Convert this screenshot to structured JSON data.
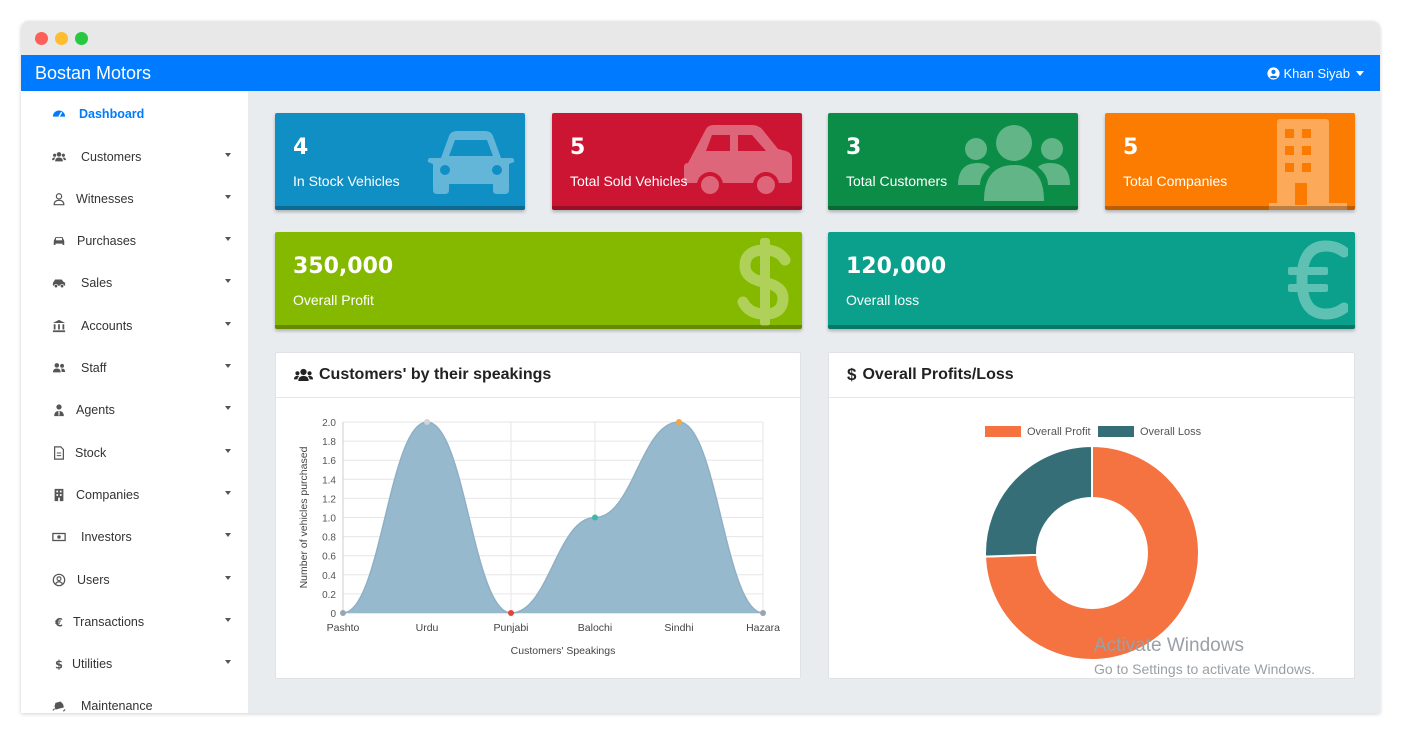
{
  "app": {
    "brand": "Bostan Motors",
    "user_name": "Khan Siyab"
  },
  "sidebar": {
    "items": [
      {
        "label": "Dashboard",
        "icon": "dashboard-icon",
        "active": true,
        "has_caret": false
      },
      {
        "label": "Customers",
        "icon": "users-icon",
        "active": false,
        "has_caret": true
      },
      {
        "label": "Witnesses",
        "icon": "user-icon",
        "active": false,
        "has_caret": true
      },
      {
        "label": "Purchases",
        "icon": "car-icon",
        "active": false,
        "has_caret": true
      },
      {
        "label": "Sales",
        "icon": "car-side-icon",
        "active": false,
        "has_caret": true
      },
      {
        "label": "Accounts",
        "icon": "building-columns-icon",
        "active": false,
        "has_caret": true
      },
      {
        "label": "Staff",
        "icon": "user-friends-icon",
        "active": false,
        "has_caret": true
      },
      {
        "label": "Agents",
        "icon": "user-tie-icon",
        "active": false,
        "has_caret": true
      },
      {
        "label": "Stock",
        "icon": "file-icon",
        "active": false,
        "has_caret": true
      },
      {
        "label": "Companies",
        "icon": "building-icon",
        "active": false,
        "has_caret": true
      },
      {
        "label": "Investors",
        "icon": "money-bill-icon",
        "active": false,
        "has_caret": true
      },
      {
        "label": "Users",
        "icon": "user-circle-icon",
        "active": false,
        "has_caret": true
      },
      {
        "label": "Transactions",
        "icon": "euro-icon",
        "active": false,
        "has_caret": true
      },
      {
        "label": "Utilities",
        "icon": "dollar-icon",
        "active": false,
        "has_caret": true
      },
      {
        "label": "Maintenance",
        "icon": "car-crash-icon",
        "active": false,
        "has_caret": false
      }
    ]
  },
  "stats": [
    {
      "value": "4",
      "label": "In Stock Vehicles",
      "color": "#0f8fc4",
      "icon": "car-front-icon"
    },
    {
      "value": "5",
      "label": "Total Sold Vehicles",
      "color": "#cc1433",
      "icon": "car-side-icon"
    },
    {
      "value": "3",
      "label": "Total Customers",
      "color": "#0c8d47",
      "icon": "users-icon"
    },
    {
      "value": "5",
      "label": "Total Companies",
      "color": "#fb7c00",
      "icon": "building-icon"
    },
    {
      "value": "350,000",
      "label": "Overall Profit",
      "color": "#85b900",
      "icon": "dollar-icon"
    },
    {
      "value": "120,000",
      "label": "Overall loss",
      "color": "#0aa08b",
      "icon": "euro-icon"
    }
  ],
  "panels": {
    "speakings_title": "Customers' by their speakings",
    "profits_title": "Overall Profits/Loss"
  },
  "chart_data": [
    {
      "type": "area",
      "title": "Customers' by their speakings",
      "categories": [
        "Pashto",
        "Urdu",
        "Punjabi",
        "Balochi",
        "Sindhi",
        "Hazara"
      ],
      "series": [
        {
          "values": [
            0,
            2,
            0,
            1,
            2,
            0
          ]
        }
      ],
      "point_colors": [
        "#9aa5b1",
        "#cfd4d8",
        "#e8423c",
        "#3fb8a8",
        "#f6a63c",
        "#9aa5b1"
      ],
      "xlabel": "Customers' Speakings",
      "ylabel": "Number of vehicles purchased",
      "ylim": [
        0,
        2
      ],
      "yticks": [
        "0",
        "0.2",
        "0.4",
        "0.6",
        "0.8",
        "1.0",
        "1.2",
        "1.4",
        "1.6",
        "1.8",
        "2.0"
      ],
      "fill_color": "#97b9cd",
      "grid": true
    },
    {
      "type": "pie",
      "title": "Overall Profits/Loss",
      "labels": [
        "Overall Profit",
        "Overall Loss"
      ],
      "values": [
        350000,
        120000
      ],
      "colors": [
        "#f57241",
        "#366e78"
      ],
      "legend": "top",
      "donut": true
    }
  ],
  "watermark": {
    "line1": "Activate Windows",
    "line2": "Go to Settings to activate Windows."
  }
}
